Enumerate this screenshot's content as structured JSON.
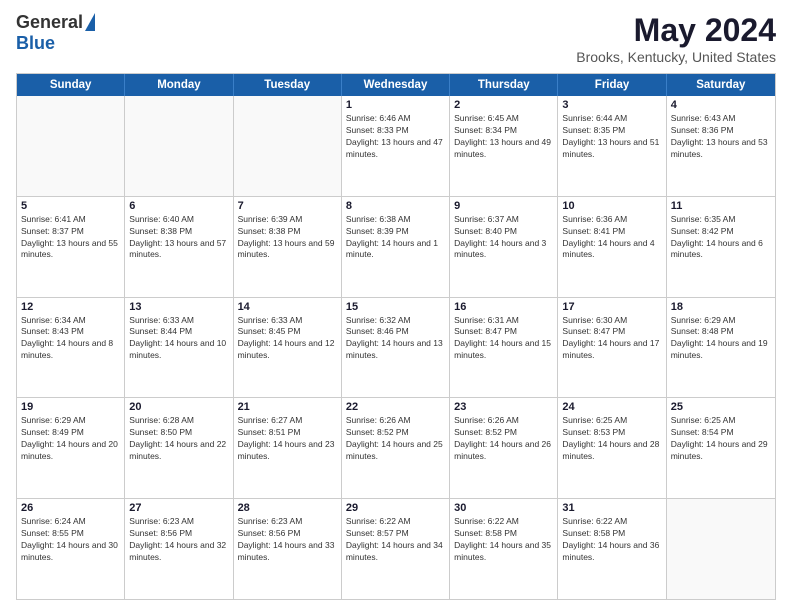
{
  "header": {
    "logo_general": "General",
    "logo_blue": "Blue",
    "month_title": "May 2024",
    "location": "Brooks, Kentucky, United States"
  },
  "days_of_week": [
    "Sunday",
    "Monday",
    "Tuesday",
    "Wednesday",
    "Thursday",
    "Friday",
    "Saturday"
  ],
  "weeks": [
    [
      {
        "day": "",
        "sunrise": "",
        "sunset": "",
        "daylight": ""
      },
      {
        "day": "",
        "sunrise": "",
        "sunset": "",
        "daylight": ""
      },
      {
        "day": "",
        "sunrise": "",
        "sunset": "",
        "daylight": ""
      },
      {
        "day": "1",
        "sunrise": "Sunrise: 6:46 AM",
        "sunset": "Sunset: 8:33 PM",
        "daylight": "Daylight: 13 hours and 47 minutes."
      },
      {
        "day": "2",
        "sunrise": "Sunrise: 6:45 AM",
        "sunset": "Sunset: 8:34 PM",
        "daylight": "Daylight: 13 hours and 49 minutes."
      },
      {
        "day": "3",
        "sunrise": "Sunrise: 6:44 AM",
        "sunset": "Sunset: 8:35 PM",
        "daylight": "Daylight: 13 hours and 51 minutes."
      },
      {
        "day": "4",
        "sunrise": "Sunrise: 6:43 AM",
        "sunset": "Sunset: 8:36 PM",
        "daylight": "Daylight: 13 hours and 53 minutes."
      }
    ],
    [
      {
        "day": "5",
        "sunrise": "Sunrise: 6:41 AM",
        "sunset": "Sunset: 8:37 PM",
        "daylight": "Daylight: 13 hours and 55 minutes."
      },
      {
        "day": "6",
        "sunrise": "Sunrise: 6:40 AM",
        "sunset": "Sunset: 8:38 PM",
        "daylight": "Daylight: 13 hours and 57 minutes."
      },
      {
        "day": "7",
        "sunrise": "Sunrise: 6:39 AM",
        "sunset": "Sunset: 8:38 PM",
        "daylight": "Daylight: 13 hours and 59 minutes."
      },
      {
        "day": "8",
        "sunrise": "Sunrise: 6:38 AM",
        "sunset": "Sunset: 8:39 PM",
        "daylight": "Daylight: 14 hours and 1 minute."
      },
      {
        "day": "9",
        "sunrise": "Sunrise: 6:37 AM",
        "sunset": "Sunset: 8:40 PM",
        "daylight": "Daylight: 14 hours and 3 minutes."
      },
      {
        "day": "10",
        "sunrise": "Sunrise: 6:36 AM",
        "sunset": "Sunset: 8:41 PM",
        "daylight": "Daylight: 14 hours and 4 minutes."
      },
      {
        "day": "11",
        "sunrise": "Sunrise: 6:35 AM",
        "sunset": "Sunset: 8:42 PM",
        "daylight": "Daylight: 14 hours and 6 minutes."
      }
    ],
    [
      {
        "day": "12",
        "sunrise": "Sunrise: 6:34 AM",
        "sunset": "Sunset: 8:43 PM",
        "daylight": "Daylight: 14 hours and 8 minutes."
      },
      {
        "day": "13",
        "sunrise": "Sunrise: 6:33 AM",
        "sunset": "Sunset: 8:44 PM",
        "daylight": "Daylight: 14 hours and 10 minutes."
      },
      {
        "day": "14",
        "sunrise": "Sunrise: 6:33 AM",
        "sunset": "Sunset: 8:45 PM",
        "daylight": "Daylight: 14 hours and 12 minutes."
      },
      {
        "day": "15",
        "sunrise": "Sunrise: 6:32 AM",
        "sunset": "Sunset: 8:46 PM",
        "daylight": "Daylight: 14 hours and 13 minutes."
      },
      {
        "day": "16",
        "sunrise": "Sunrise: 6:31 AM",
        "sunset": "Sunset: 8:47 PM",
        "daylight": "Daylight: 14 hours and 15 minutes."
      },
      {
        "day": "17",
        "sunrise": "Sunrise: 6:30 AM",
        "sunset": "Sunset: 8:47 PM",
        "daylight": "Daylight: 14 hours and 17 minutes."
      },
      {
        "day": "18",
        "sunrise": "Sunrise: 6:29 AM",
        "sunset": "Sunset: 8:48 PM",
        "daylight": "Daylight: 14 hours and 19 minutes."
      }
    ],
    [
      {
        "day": "19",
        "sunrise": "Sunrise: 6:29 AM",
        "sunset": "Sunset: 8:49 PM",
        "daylight": "Daylight: 14 hours and 20 minutes."
      },
      {
        "day": "20",
        "sunrise": "Sunrise: 6:28 AM",
        "sunset": "Sunset: 8:50 PM",
        "daylight": "Daylight: 14 hours and 22 minutes."
      },
      {
        "day": "21",
        "sunrise": "Sunrise: 6:27 AM",
        "sunset": "Sunset: 8:51 PM",
        "daylight": "Daylight: 14 hours and 23 minutes."
      },
      {
        "day": "22",
        "sunrise": "Sunrise: 6:26 AM",
        "sunset": "Sunset: 8:52 PM",
        "daylight": "Daylight: 14 hours and 25 minutes."
      },
      {
        "day": "23",
        "sunrise": "Sunrise: 6:26 AM",
        "sunset": "Sunset: 8:52 PM",
        "daylight": "Daylight: 14 hours and 26 minutes."
      },
      {
        "day": "24",
        "sunrise": "Sunrise: 6:25 AM",
        "sunset": "Sunset: 8:53 PM",
        "daylight": "Daylight: 14 hours and 28 minutes."
      },
      {
        "day": "25",
        "sunrise": "Sunrise: 6:25 AM",
        "sunset": "Sunset: 8:54 PM",
        "daylight": "Daylight: 14 hours and 29 minutes."
      }
    ],
    [
      {
        "day": "26",
        "sunrise": "Sunrise: 6:24 AM",
        "sunset": "Sunset: 8:55 PM",
        "daylight": "Daylight: 14 hours and 30 minutes."
      },
      {
        "day": "27",
        "sunrise": "Sunrise: 6:23 AM",
        "sunset": "Sunset: 8:56 PM",
        "daylight": "Daylight: 14 hours and 32 minutes."
      },
      {
        "day": "28",
        "sunrise": "Sunrise: 6:23 AM",
        "sunset": "Sunset: 8:56 PM",
        "daylight": "Daylight: 14 hours and 33 minutes."
      },
      {
        "day": "29",
        "sunrise": "Sunrise: 6:22 AM",
        "sunset": "Sunset: 8:57 PM",
        "daylight": "Daylight: 14 hours and 34 minutes."
      },
      {
        "day": "30",
        "sunrise": "Sunrise: 6:22 AM",
        "sunset": "Sunset: 8:58 PM",
        "daylight": "Daylight: 14 hours and 35 minutes."
      },
      {
        "day": "31",
        "sunrise": "Sunrise: 6:22 AM",
        "sunset": "Sunset: 8:58 PM",
        "daylight": "Daylight: 14 hours and 36 minutes."
      },
      {
        "day": "",
        "sunrise": "",
        "sunset": "",
        "daylight": ""
      }
    ]
  ]
}
